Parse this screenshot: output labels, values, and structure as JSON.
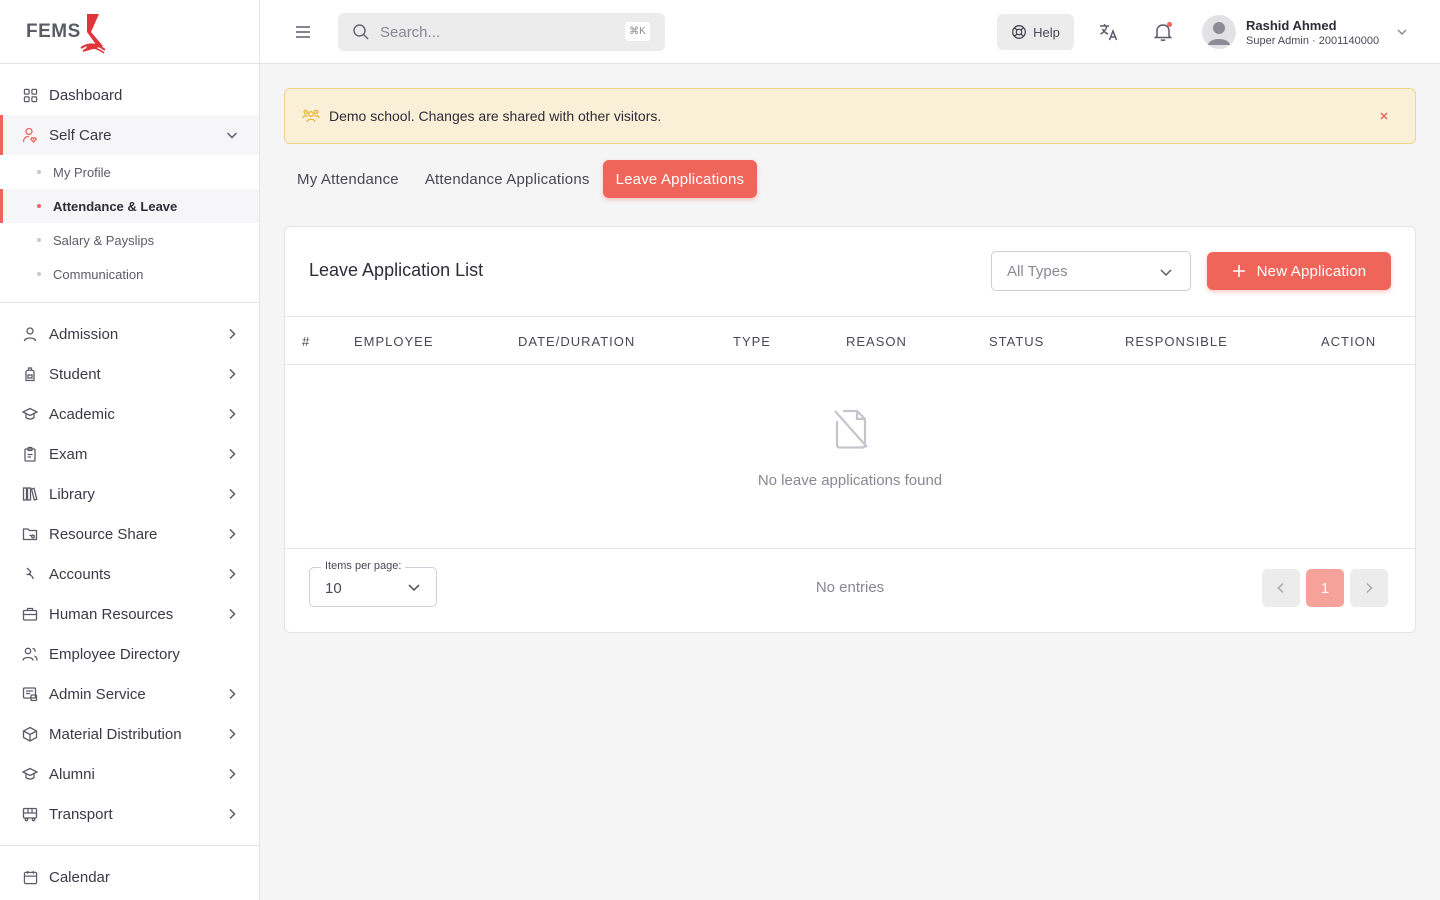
{
  "app": {
    "logo_text": "FEMS"
  },
  "sidebar": {
    "dashboard": "Dashboard",
    "self_care": {
      "label": "Self Care",
      "items": [
        "My Profile",
        "Attendance & Leave",
        "Salary & Payslips",
        "Communication"
      ]
    },
    "modules": [
      {
        "label": "Admission",
        "icon": "person-icon",
        "arrow": true
      },
      {
        "label": "Student",
        "icon": "backpack-icon",
        "arrow": true
      },
      {
        "label": "Academic",
        "icon": "graduation-cap-icon",
        "arrow": true
      },
      {
        "label": "Exam",
        "icon": "clipboard-icon",
        "arrow": true
      },
      {
        "label": "Library",
        "icon": "books-icon",
        "arrow": true
      },
      {
        "label": "Resource Share",
        "icon": "folder-share-icon",
        "arrow": true
      },
      {
        "label": "Accounts",
        "icon": "money-icon",
        "arrow": true
      },
      {
        "label": "Human Resources",
        "icon": "briefcase-icon",
        "arrow": true
      },
      {
        "label": "Employee Directory",
        "icon": "users-icon",
        "arrow": false
      },
      {
        "label": "Admin Service",
        "icon": "admin-service-icon",
        "arrow": true
      },
      {
        "label": "Material Distribution",
        "icon": "box-icon",
        "arrow": true
      },
      {
        "label": "Alumni",
        "icon": "graduation-cap-icon",
        "arrow": true
      },
      {
        "label": "Transport",
        "icon": "bus-icon",
        "arrow": true
      }
    ],
    "calendar": "Calendar"
  },
  "topbar": {
    "search_placeholder": "Search...",
    "search_shortcut": "⌘K",
    "help_label": "Help",
    "user": {
      "name": "Rashid Ahmed",
      "role": "Super Admin · 2001140000"
    }
  },
  "alert": {
    "text": "Demo school. Changes are shared with other visitors."
  },
  "tabs": [
    "My Attendance",
    "Attendance Applications",
    "Leave Applications"
  ],
  "card": {
    "title": "Leave Application List",
    "type_filter": "All Types",
    "new_button": "New Application",
    "columns": [
      "#",
      "EMPLOYEE",
      "DATE/DURATION",
      "TYPE",
      "REASON",
      "STATUS",
      "RESPONSIBLE",
      "ACTION"
    ],
    "empty_text": "No leave applications found",
    "items_per_page_label": "Items per page:",
    "items_per_page": "10",
    "entries_text": "No entries",
    "current_page": "1"
  },
  "colors": {
    "accent": "#f0655a",
    "alert_bg": "#faf0d8",
    "alert_border": "#f0d68a"
  }
}
